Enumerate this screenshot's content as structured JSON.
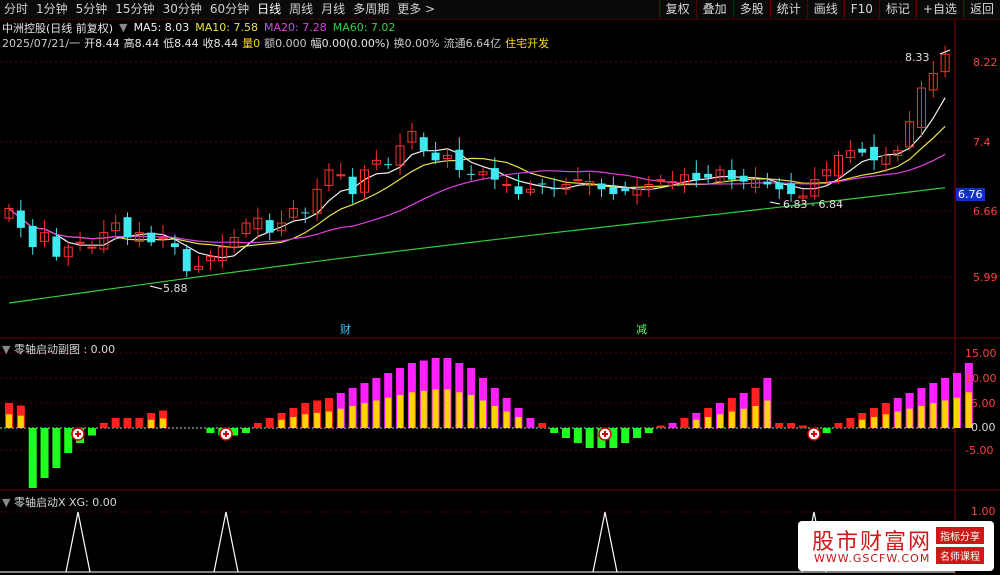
{
  "toolbar": {
    "periods": [
      "分时",
      "1分钟",
      "5分钟",
      "15分钟",
      "30分钟",
      "60分钟",
      "日线",
      "周线",
      "月线",
      "多周期",
      "更多 >"
    ],
    "active_period": "日线",
    "buttons": [
      "复权",
      "叠加",
      "多股",
      "统计",
      "画线",
      "F10",
      "标记",
      "+自选",
      "返回"
    ]
  },
  "stock": {
    "name": "中洲控股(日线 前复权)",
    "ma5": "MA5: 8.03",
    "ma10": "MA10: 7.58",
    "ma20": "MA20: 7.28",
    "ma60": "MA60: 7.02",
    "date": "2025/07/21/一",
    "open": "开8.44",
    "high": "高8.44",
    "low": "低8.44",
    "close": "收8.44",
    "volume": "量0",
    "amount": "额0.000",
    "amplitude": "幅0.00(0.00%)",
    "turnover": "换0.00%",
    "float_cap": "流通6.64亿",
    "sector": "住宅开发"
  },
  "colors": {
    "up": "#ff3030",
    "down": "#40e8f0",
    "ma5": "#f0f0f0",
    "ma10": "#e8e24a",
    "ma20": "#e040e0",
    "ma60": "#30d040",
    "macd_pos_magenta": "#ff20ff",
    "macd_pos_red": "#ff2020",
    "macd_neg": "#20ff20",
    "macd_inner": "#ffd400",
    "axis_red": "#ff3030"
  },
  "chart_data": [
    {
      "type": "candlestick",
      "title": "中洲控股(日线 前复权)",
      "y_ticks": [
        8.22,
        7.4,
        6.66,
        5.99
      ],
      "ylim": [
        5.5,
        8.5
      ],
      "current_price_tag": "6.76",
      "annotations": [
        "8.33",
        "6.83 - 6.84",
        "5.88",
        "财",
        "减"
      ],
      "series_names": [
        "MA5",
        "MA10",
        "MA20",
        "MA60"
      ]
    },
    {
      "type": "bar",
      "title": "零轴启动副图 : 0.00",
      "y_ticks": [
        "15.00",
        "10.00",
        "5.00",
        "0.00",
        "-5.00"
      ],
      "ylim": [
        -8,
        16
      ]
    },
    {
      "type": "line",
      "title": "零轴启动X XG: 0.00",
      "y_ticks": [
        "1.00"
      ],
      "ylim": [
        0,
        1
      ]
    }
  ],
  "watermark": {
    "title": "股市财富网",
    "url": "WWW.GSCFW.COM",
    "tag1": "指标分享",
    "tag2": "名师课程"
  }
}
